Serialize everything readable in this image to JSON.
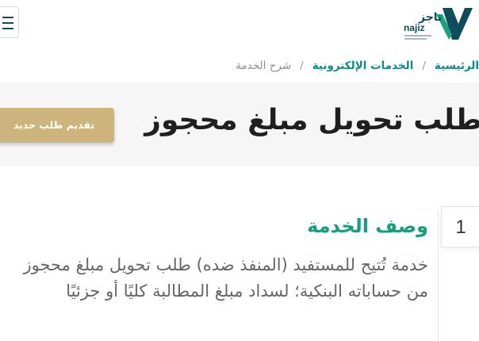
{
  "header": {
    "logo": {
      "arabic_text": "ناجز",
      "latin_text": "najiz",
      "colors": {
        "green": "#1aa37a",
        "navy": "#0f4c5c"
      }
    },
    "menu_icon": "hamburger-menu-icon"
  },
  "breadcrumb": {
    "items": [
      "الرئيسية",
      "الخدمات الإلكترونية",
      "شرح الخدمة"
    ],
    "separator": "/"
  },
  "hero": {
    "title": "طلب تحويل مبلغ محجوز",
    "new_request_label": "تقديم طلب جديد"
  },
  "section": {
    "step_number": "1",
    "title": "وصف الخدمة",
    "description": "خدمة تُتيح للمستفيد (المنفذ ضده) طلب تحويل مبلغ محجوز من حساباته البنكية؛ لسداد مبلغ المطالبة كليًا أو جزئيًا"
  },
  "colors": {
    "accent_green": "#1a9c7f",
    "link_teal": "#0e8a87",
    "gold_button": "#ccb47c",
    "hero_bg": "#f6f6f6"
  }
}
